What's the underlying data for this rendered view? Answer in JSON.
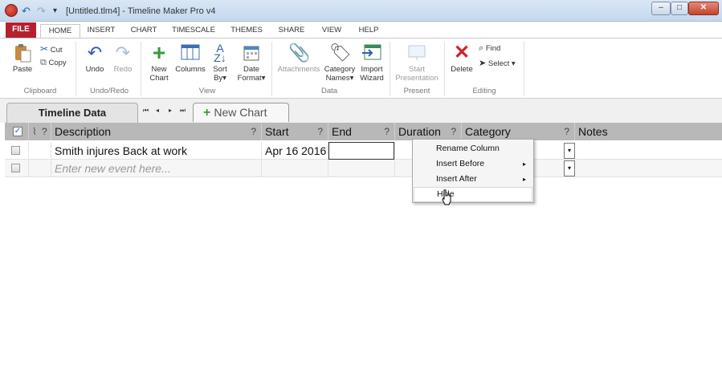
{
  "window": {
    "title": "[Untitled.tlm4] - Timeline Maker Pro v4",
    "controls": {
      "minimize": "–",
      "maximize": "□",
      "close": "✕"
    }
  },
  "quick_access": {
    "undo_icon": "↶",
    "redo_icon": "↷",
    "dropdown_icon": "▾"
  },
  "ribbon_tabs": [
    "FILE",
    "HOME",
    "INSERT",
    "CHART",
    "TIMESCALE",
    "THEMES",
    "SHARE",
    "VIEW",
    "HELP"
  ],
  "ribbon": {
    "clipboard": {
      "paste": "Paste",
      "cut": "Cut",
      "copy": "Copy",
      "group": "Clipboard"
    },
    "undoredo": {
      "undo": "Undo",
      "redo": "Redo",
      "group": "Undo/Redo"
    },
    "view": {
      "new_chart_1": "New",
      "new_chart_2": "Chart",
      "columns": "Columns",
      "sort_1": "Sort",
      "sort_2": "By",
      "date_format_1": "Date",
      "date_format_2": "Format",
      "group": "View"
    },
    "data": {
      "attachments": "Attachments",
      "category_names_1": "Category",
      "category_names_2": "Names",
      "import_1": "Import",
      "import_2": "Wizard",
      "group": "Data"
    },
    "present": {
      "start_1": "Start",
      "start_2": "Presentation",
      "group": "Present"
    },
    "editing": {
      "delete": "Delete",
      "find": "Find",
      "select": "Select",
      "group": "Editing"
    }
  },
  "sheet_tabs": {
    "active": "Timeline Data",
    "new_chart": "New Chart",
    "new_chart_icon": "+"
  },
  "sheet_nav": {
    "first": "⏮",
    "prev": "◂",
    "next": "▸",
    "last": "⏭"
  },
  "grid": {
    "checkmark": "✓",
    "headers": {
      "description": "Description",
      "start": "Start",
      "end": "End",
      "duration": "Duration",
      "category": "Category",
      "notes": "Notes",
      "help": "?"
    },
    "rows": [
      {
        "description": "Smith injures Back at work",
        "start": "Apr 16 2016",
        "end": "",
        "duration": "",
        "category": "",
        "notes": ""
      }
    ],
    "new_row_placeholder": "Enter new event here...",
    "dropdown_icon": "▾"
  },
  "context_menu": {
    "items": [
      "Rename Column",
      "Insert Before",
      "Insert After",
      "Hide"
    ],
    "submenu_arrow": "▸"
  }
}
